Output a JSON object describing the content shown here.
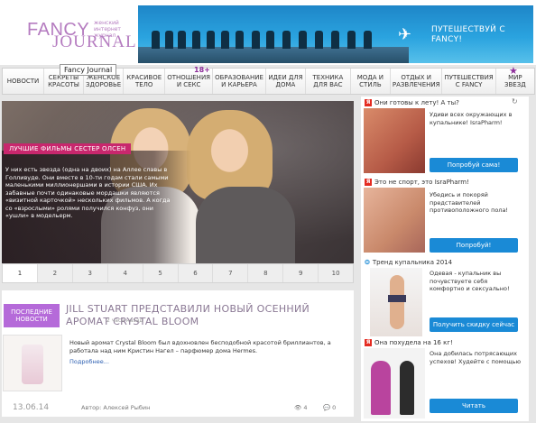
{
  "logo": {
    "line1": "FANCY",
    "line2": "JOURNAL",
    "tagline": "женский интернет журнал"
  },
  "banner": {
    "text": "ПУТЕШЕСТВУЙ С FANCY!"
  },
  "tooltip": "Fancy Journal",
  "nav": {
    "items": [
      "НОВОСТИ",
      "СЕКРЕТЫ КРАСОТЫ",
      "ЖЕНСКОЕ ЗДОРОВЬЕ",
      "КРАСИВОЕ ТЕЛО",
      "ОТНОШЕНИЯ И СЕКС",
      "ОБРАЗОВАНИЕ И КАРЬЕРА",
      "ИДЕИ ДЛЯ ДОМА",
      "ТЕХНИКА ДЛЯ ВАС",
      "МОДА И СТИЛЬ",
      "ОТДЫХ И РАЗВЛЕЧЕНИЯ",
      "ПУТЕШЕСТВИЯ С FANCY",
      "МИР ЗВЕЗД"
    ],
    "badge": "18+"
  },
  "slider": {
    "ribbon": "ЛУЧШИЕ ФИЛЬМЫ СЕСТЕР ОЛСЕН",
    "text": "У них есть звезда (одна на двоих) на Аллее славы в Голливуде. Они вместе в 10-ти годам стали самыми маленькими миллионершами в истории США. Их забавные почти одинаковые мордашки являются «визитной карточкой» нескольких фильмов. А когда со «взрослыми» ролями получился конфуз, они «ушли» в модельерм.",
    "pages": [
      "1",
      "2",
      "3",
      "4",
      "5",
      "6",
      "7",
      "8",
      "9",
      "10"
    ]
  },
  "latest": {
    "badge": "ПОСЛЕДНИЕ НОВОСТИ",
    "title": "JILL STUART ПРЕДСТАВИЛИ НОВЫЙ ОСЕННИЙ АРОМАТ CRYSTAL BLOOM",
    "time": "2 часа назад",
    "body": "Новый аромат Crystal Bloom был вдохновлен бесподобной красотой бриллиантов, а работала над ним Кристин Нагел – парфюмер дома Hermes.",
    "more": "Подробнее...",
    "date": "13.06.14",
    "author": "Автор: Алексей Рыбин",
    "views": "4",
    "comments": "0"
  },
  "ads": [
    {
      "title": "Они готовы к лету! А ты?",
      "text": "Удиви всех окружающих в купальнике! IsraPharm!",
      "button": "Попробуй сама!"
    },
    {
      "title": "Это не спорт, это IsraPharm!",
      "text": "Убедись и покоряй представителей противоположного пола!",
      "button": "Попробуй!"
    },
    {
      "title": "Тренд купальника 2014",
      "text": "Одевая - купальник вы почувствуете себя комфортно и сексуально!",
      "button": "Получить скидку сейчас"
    },
    {
      "title": "Она похудела на 16 кг!",
      "text": "Она добилась потрясающих успехов! Худейте с помощью",
      "button": "Читать"
    }
  ],
  "colors": {
    "accent": "#b56ad9",
    "ribbon": "#c8276d",
    "button": "#1a8ad6",
    "banner": "#2aa3df"
  }
}
